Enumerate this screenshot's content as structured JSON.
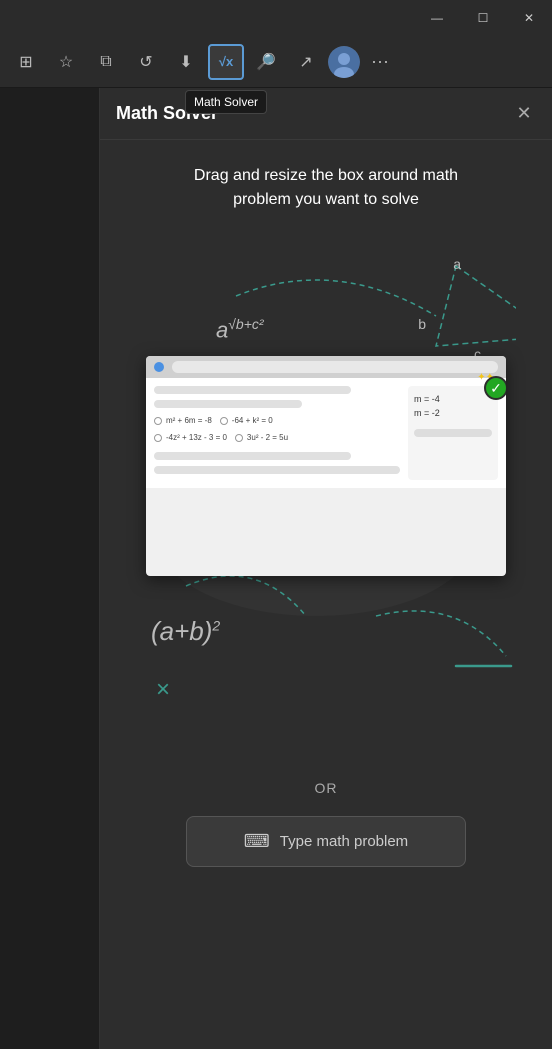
{
  "titlebar": {
    "minimize_label": "—",
    "maximize_label": "☐",
    "close_label": "✕"
  },
  "toolbar": {
    "icons": [
      {
        "name": "extensions-icon",
        "symbol": "⊞",
        "active": false
      },
      {
        "name": "favorites-icon",
        "symbol": "☆",
        "active": false
      },
      {
        "name": "collections-icon",
        "symbol": "⧉",
        "active": false
      },
      {
        "name": "history-icon",
        "symbol": "↺",
        "active": false
      },
      {
        "name": "downloads-icon",
        "symbol": "⬇",
        "active": false
      },
      {
        "name": "math-solver-icon",
        "symbol": "√x",
        "active": true
      }
    ],
    "tooltip_text": "Math Solver",
    "more_label": "···"
  },
  "panel": {
    "title": "Math Solver",
    "close_label": "✕",
    "instruction": "Drag and resize the box around math problem you want to solve",
    "or_text": "OR",
    "type_button_label": "Type math problem",
    "math_symbols": {
      "division": "÷",
      "multiply": "×",
      "formula1": "a√b+c²",
      "formula2": "(a+b)²"
    },
    "mockup": {
      "problems": [
        {
          "label": "m² + 6m = -8"
        },
        {
          "label": "-64 + k² = 0"
        },
        {
          "label": "-4z² + 13z - 3 = 0"
        },
        {
          "label": "3u² - 2 = 5u"
        }
      ],
      "result": {
        "line1": "m = -4",
        "line2": "m = -2"
      }
    }
  }
}
